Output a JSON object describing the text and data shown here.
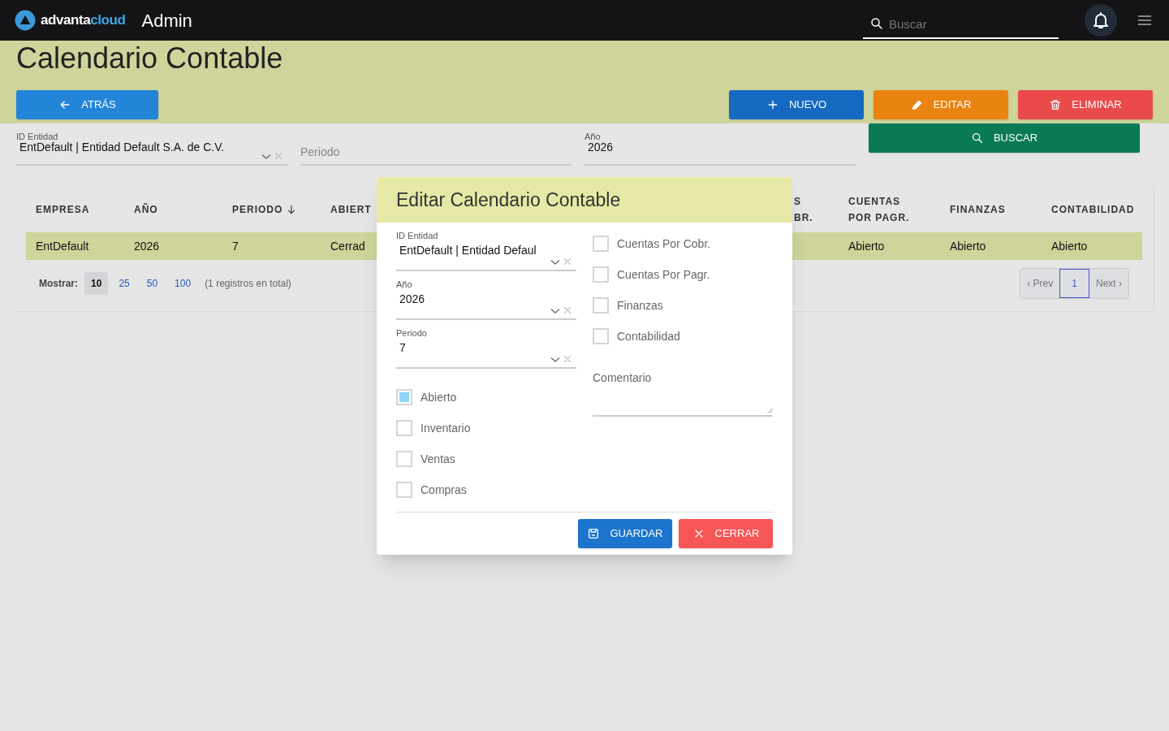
{
  "navbar": {
    "logo_text": "advanta",
    "logo_accent": "cloud",
    "app": "Admin",
    "search": {
      "placeholder": "Buscar"
    }
  },
  "page": {
    "title": "Calendario Contable"
  },
  "actions": [
    {
      "label": "ATRÁS",
      "kind": "back"
    },
    {
      "label": "NUEVO",
      "kind": "new"
    },
    {
      "label": "EDITAR",
      "kind": "edit"
    },
    {
      "label": "ELIMINAR",
      "kind": "delete"
    }
  ],
  "filters": [
    {
      "label": "ID Entidad",
      "value": "EntDefault | Entidad Default S.A. de C.V.",
      "kind": "select"
    },
    {
      "placeholder": "Periodo",
      "kind": "text"
    },
    {
      "label": "Año",
      "value": "2026",
      "kind": "text"
    }
  ],
  "search_button": "BUSCAR",
  "table": {
    "columns": [
      {
        "label": "EMPRESA",
        "sorted": false
      },
      {
        "label": "AÑO",
        "sorted": false
      },
      {
        "label": "PERIODO",
        "sorted": true
      },
      {
        "label": "ABIERT",
        "sorted": false
      },
      {
        "label": "S BR.",
        "sorted": false
      },
      {
        "label": "CUENTAS POR PAGR.",
        "sorted": false
      },
      {
        "label": "FINANZAS",
        "sorted": false
      },
      {
        "label": "CONTABILIDAD",
        "sorted": false
      }
    ],
    "rows": [
      {
        "selected": true,
        "cells": [
          "EntDefault",
          "2026",
          "7",
          "Cerrad",
          null,
          "Abierto",
          "Abierto",
          "Abierto"
        ]
      }
    ]
  },
  "footer": {
    "show_label": "Mostrar:",
    "page_sizes": [
      {
        "label": "10",
        "selected": true
      },
      {
        "label": "25",
        "selected": false
      },
      {
        "label": "50",
        "selected": false
      },
      {
        "label": "100",
        "selected": false
      }
    ],
    "total": "(1 registros en total)",
    "pager": [
      {
        "label": "‹ Prev",
        "selected": false
      },
      {
        "label": "1",
        "selected": true
      },
      {
        "label": "Next ›",
        "selected": false
      }
    ]
  },
  "modal": {
    "title": "Editar Calendario Contable",
    "fields": [
      {
        "label": "ID Entidad",
        "value": "EntDefault | Entidad Defaul"
      },
      {
        "label": "Año",
        "value": "2026"
      },
      {
        "label": "Periodo",
        "value": "7"
      }
    ],
    "left_checks": [
      {
        "label": "Abierto",
        "checked": true
      },
      {
        "label": "Inventario",
        "checked": false
      },
      {
        "label": "Ventas",
        "checked": false
      },
      {
        "label": "Compras",
        "checked": false
      }
    ],
    "right_checks": [
      {
        "label": "Cuentas Por Cobr.",
        "checked": false
      },
      {
        "label": "Cuentas Por Pagr.",
        "checked": false
      },
      {
        "label": "Finanzas",
        "checked": false
      },
      {
        "label": "Contabilidad",
        "checked": false
      }
    ],
    "comment": {
      "label": "Comentario"
    },
    "buttons": [
      {
        "label": "GUARDAR",
        "kind": "save"
      },
      {
        "label": "CERRAR",
        "kind": "close"
      }
    ]
  }
}
